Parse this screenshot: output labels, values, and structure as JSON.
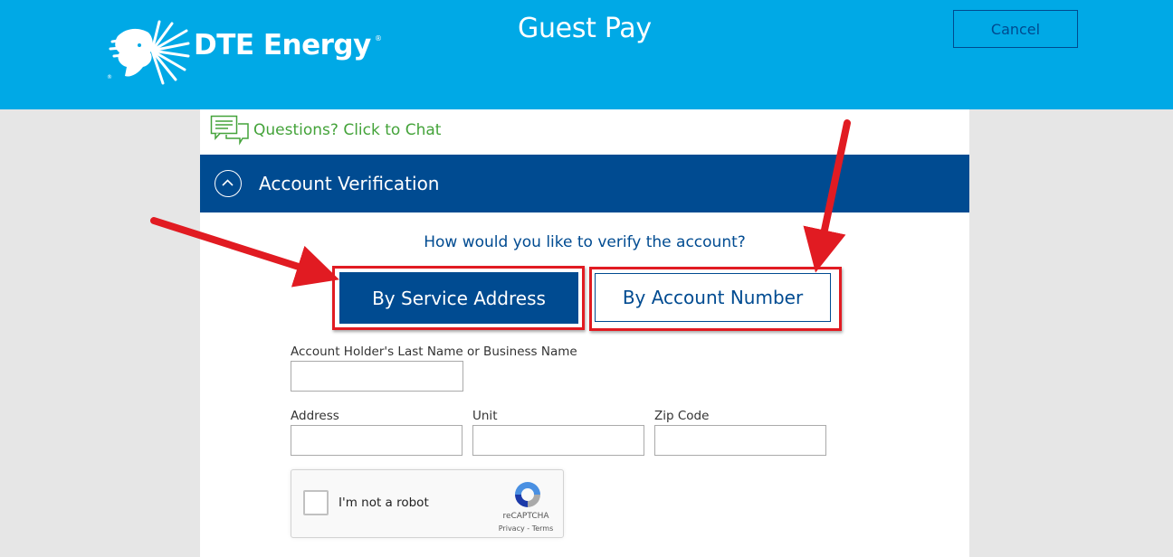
{
  "header": {
    "brand": "DTE Energy",
    "registered_mark": "®",
    "title": "Guest Pay",
    "cancel_label": "Cancel"
  },
  "chat": {
    "label": "Questions? Click to Chat"
  },
  "section": {
    "title": "Account Verification"
  },
  "verify": {
    "question": "How would you like to verify the account?",
    "options": [
      {
        "label": "By Service Address",
        "selected": true
      },
      {
        "label": "By Account Number",
        "selected": false
      }
    ]
  },
  "form": {
    "last_name_label": "Account Holder's Last Name or Business Name",
    "last_name_value": "",
    "address_label": "Address",
    "address_value": "",
    "unit_label": "Unit",
    "unit_value": "",
    "zip_label": "Zip Code",
    "zip_value": ""
  },
  "recaptcha": {
    "label": "I'm not a robot",
    "brand": "reCAPTCHA",
    "links": "Privacy - Terms"
  },
  "colors": {
    "header": "#00a9e6",
    "navy": "#004b91",
    "chat_green": "#44a33a",
    "annotation_red": "#e11b22"
  }
}
